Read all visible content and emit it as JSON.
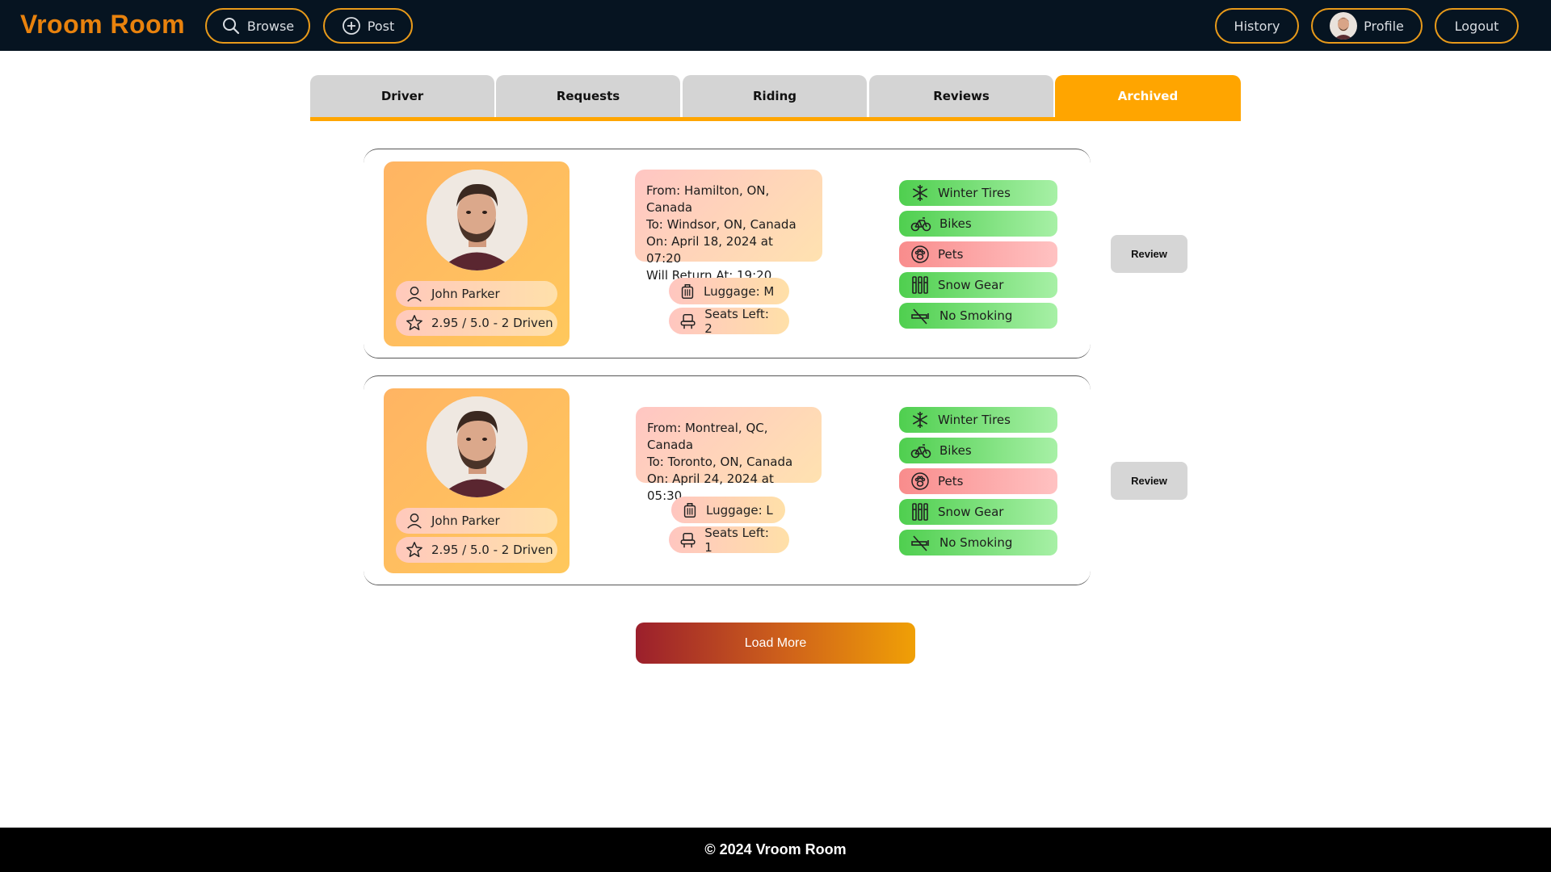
{
  "app": {
    "brand": "Vroom Room"
  },
  "header": {
    "browse_label": "Browse",
    "post_label": "Post",
    "history_label": "History",
    "profile_label": "Profile",
    "logout_label": "Logout"
  },
  "tabs": [
    {
      "label": "Driver"
    },
    {
      "label": "Requests"
    },
    {
      "label": "Riding"
    },
    {
      "label": "Reviews"
    },
    {
      "label": "Archived",
      "active": true
    }
  ],
  "rides": [
    {
      "driver_name": "John Parker",
      "rating": "2.95 / 5.0 - 2 Driven",
      "from": "From: Hamilton, ON, Canada",
      "to": "To: Windsor, ON, Canada",
      "on": "On: April 18, 2024 at 07:20",
      "return": "Will Return At: 19:20",
      "luggage": "Luggage: M",
      "seats": "Seats Left: 2",
      "features": [
        {
          "label": "Winter Tires",
          "status": "green",
          "icon": "snowflake-icon"
        },
        {
          "label": "Bikes",
          "status": "green",
          "icon": "bike-icon"
        },
        {
          "label": "Pets",
          "status": "red",
          "icon": "paw-icon"
        },
        {
          "label": "Snow Gear",
          "status": "green",
          "icon": "ski-icon"
        },
        {
          "label": "No Smoking",
          "status": "green",
          "icon": "no-smoking-icon"
        }
      ],
      "review_label": "Review"
    },
    {
      "driver_name": "John Parker",
      "rating": "2.95 / 5.0 - 2 Driven",
      "from": "From: Montreal, QC, Canada",
      "to": "To: Toronto, ON, Canada",
      "on": "On: April 24, 2024 at 05:30",
      "luggage": "Luggage: L",
      "seats": "Seats Left: 1",
      "features": [
        {
          "label": "Winter Tires",
          "status": "green",
          "icon": "snowflake-icon"
        },
        {
          "label": "Bikes",
          "status": "green",
          "icon": "bike-icon"
        },
        {
          "label": "Pets",
          "status": "red",
          "icon": "paw-icon"
        },
        {
          "label": "Snow Gear",
          "status": "green",
          "icon": "ski-icon"
        },
        {
          "label": "No Smoking",
          "status": "green",
          "icon": "no-smoking-icon"
        }
      ],
      "review_label": "Review"
    }
  ],
  "load_more_label": "Load More",
  "footer": {
    "text": "© 2024 Vroom Room"
  },
  "colors": {
    "header_bg": "#061421",
    "accent": "#ffa500",
    "brand": "#e8820d",
    "feature_ok": "#4fcf4f",
    "feature_no": "#f98c8c"
  }
}
